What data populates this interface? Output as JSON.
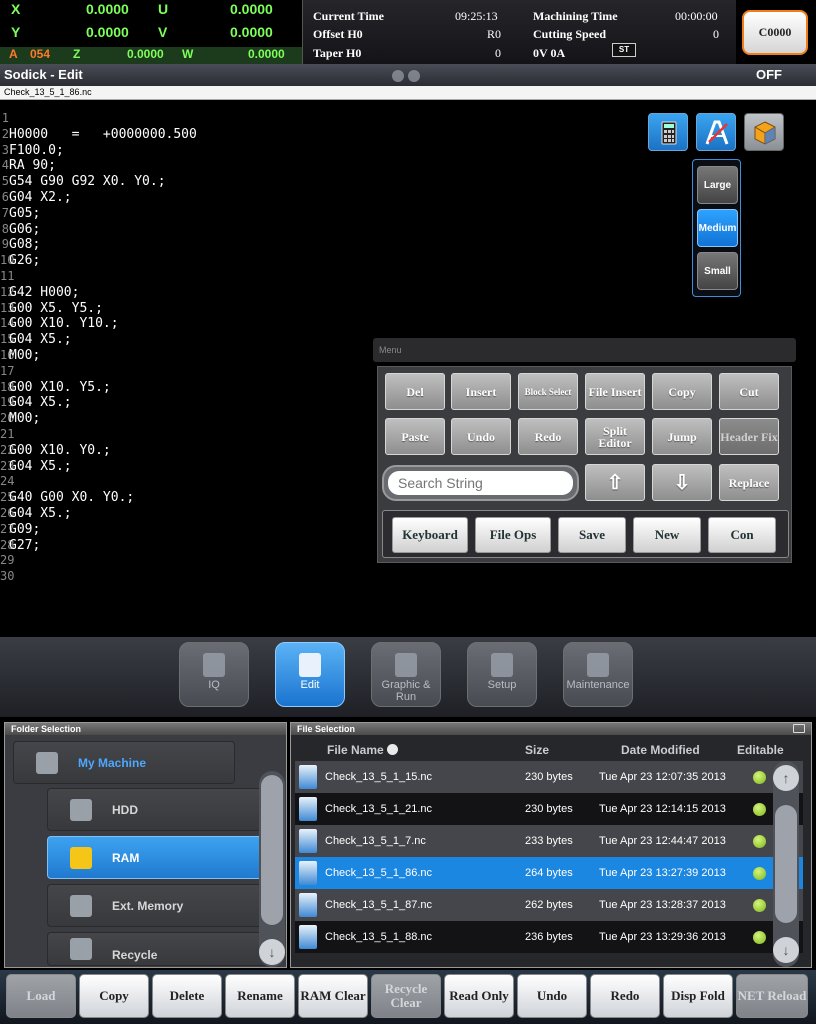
{
  "axes": {
    "x": {
      "label": "X",
      "value": "0.0000"
    },
    "y": {
      "label": "Y",
      "value": "0.0000"
    },
    "u": {
      "label": "U",
      "value": "0.0000"
    },
    "v": {
      "label": "V",
      "value": "0.0000"
    },
    "a": {
      "label": "A",
      "value": "054"
    },
    "z": {
      "label": "Z",
      "value": "0.0000"
    },
    "w": {
      "label": "W",
      "value": "0.0000"
    }
  },
  "info": {
    "current_time_label": "Current Time",
    "current_time_value": "09:25:13",
    "machining_time_label": "Machining Time",
    "machining_time_value": "00:00:00",
    "offset_label": "Offset H0",
    "offset_value": "R0",
    "cutting_speed_label": "Cutting Speed",
    "cutting_speed_value": "0",
    "taper_label": "Taper H0",
    "taper_value": "0",
    "voltage_value": "0V  0A",
    "st_badge": "ST",
    "c_button": "C0000"
  },
  "title": {
    "text": "Sodick - Edit",
    "status": "OFF",
    "filename": "Check_13_5_1_86.nc"
  },
  "editor": {
    "lines": [
      {
        "n": "1",
        "code": ""
      },
      {
        "n": "2",
        "code": "H0000   =   +0000000.500"
      },
      {
        "n": "3",
        "code": "F100.0;"
      },
      {
        "n": "4",
        "code": "RA 90;"
      },
      {
        "n": "5",
        "code": "G54 G90 G92 X0. Y0.;"
      },
      {
        "n": "6",
        "code": "G04 X2.;"
      },
      {
        "n": "7",
        "code": "G05;"
      },
      {
        "n": "8",
        "code": "G06;"
      },
      {
        "n": "9",
        "code": "G08;"
      },
      {
        "n": "10",
        "code": "G26;"
      },
      {
        "n": "11",
        "code": ""
      },
      {
        "n": "12",
        "code": "G42 H000;"
      },
      {
        "n": "13",
        "code": "G00 X5. Y5.;"
      },
      {
        "n": "14",
        "code": "G00 X10. Y10.;"
      },
      {
        "n": "15",
        "code": "G04 X5.;"
      },
      {
        "n": "16",
        "code": "M00;"
      },
      {
        "n": "17",
        "code": ""
      },
      {
        "n": "18",
        "code": "G00 X10. Y5.;"
      },
      {
        "n": "19",
        "code": "G04 X5.;"
      },
      {
        "n": "20",
        "code": "M00;"
      },
      {
        "n": "21",
        "code": ""
      },
      {
        "n": "22",
        "code": "G00 X10. Y0.;"
      },
      {
        "n": "23",
        "code": "G04 X5.;"
      },
      {
        "n": "24",
        "code": ""
      },
      {
        "n": "25",
        "code": "G40 G00 X0. Y0.;"
      },
      {
        "n": "26",
        "code": "G04 X5.;"
      },
      {
        "n": "27",
        "code": "G09;"
      },
      {
        "n": "28",
        "code": "G27;"
      },
      {
        "n": "29",
        "code": ""
      },
      {
        "n": "30",
        "code": ""
      }
    ],
    "size_large": "Large",
    "size_medium": "Medium",
    "size_small": "Small"
  },
  "menu": {
    "title": "Menu",
    "del": "Del",
    "insert": "Insert",
    "block_select": "Block Select",
    "file_insert": "File Insert",
    "copy": "Copy",
    "cut": "Cut",
    "paste": "Paste",
    "undo": "Undo",
    "redo": "Redo",
    "split_editor": "Split Editor",
    "jump": "Jump",
    "header_fix": "Header Fix",
    "search_placeholder": "Search String",
    "up_arrow": "⇧",
    "down_arrow": "⇩",
    "replace": "Replace",
    "keyboard": "Keyboard",
    "file_ops": "File Ops",
    "save": "Save",
    "new": "New",
    "con": "Con"
  },
  "modes": {
    "iq": "IQ",
    "edit": "Edit",
    "graphic_run": "Graphic & Run",
    "setup": "Setup",
    "maintenance": "Maintenance"
  },
  "folders": {
    "title": "Folder Selection",
    "my_machine": "My Machine",
    "hdd": "HDD",
    "ram": "RAM",
    "ext_memory": "Ext. Memory",
    "recycle": "Recycle"
  },
  "files": {
    "title": "File Selection",
    "col_name": "File Name",
    "col_size": "Size",
    "col_date": "Date Modified",
    "col_editable": "Editable",
    "rows": [
      {
        "name": "Check_13_5_1_15.nc",
        "size": "230 bytes",
        "date": "Tue Apr 23 12:07:35 2013"
      },
      {
        "name": "Check_13_5_1_21.nc",
        "size": "230 bytes",
        "date": "Tue Apr 23 12:14:15 2013"
      },
      {
        "name": "Check_13_5_1_7.nc",
        "size": "233 bytes",
        "date": "Tue Apr 23 12:44:47 2013"
      },
      {
        "name": "Check_13_5_1_86.nc",
        "size": "264 bytes",
        "date": "Tue Apr 23 13:27:39 2013"
      },
      {
        "name": "Check_13_5_1_87.nc",
        "size": "262 bytes",
        "date": "Tue Apr 23 13:28:37 2013"
      },
      {
        "name": "Check_13_5_1_88.nc",
        "size": "236 bytes",
        "date": "Tue Apr 23 13:29:36 2013"
      }
    ]
  },
  "bottom": {
    "load": "Load",
    "copy": "Copy",
    "delete": "Delete",
    "rename": "Rename",
    "ram_clear": "RAM Clear",
    "recycle_clear": "Recycle Clear",
    "read_only": "Read Only",
    "undo": "Undo",
    "redo": "Redo",
    "disp_fold": "Disp Fold",
    "net_reload": "NET Reload"
  },
  "colors": {
    "accent": "#1c87e0",
    "axis_green": "#7dff5a",
    "axis_orange": "#ff7a29",
    "c_button_border": "#f07d16"
  },
  "icons": [
    "calculator-icon",
    "font-icon",
    "cube-icon",
    "sort-up-icon",
    "grid-view-icon",
    "computer-icon",
    "hdd-icon",
    "database-icon",
    "usb-icon",
    "trash-icon",
    "document-icon"
  ]
}
